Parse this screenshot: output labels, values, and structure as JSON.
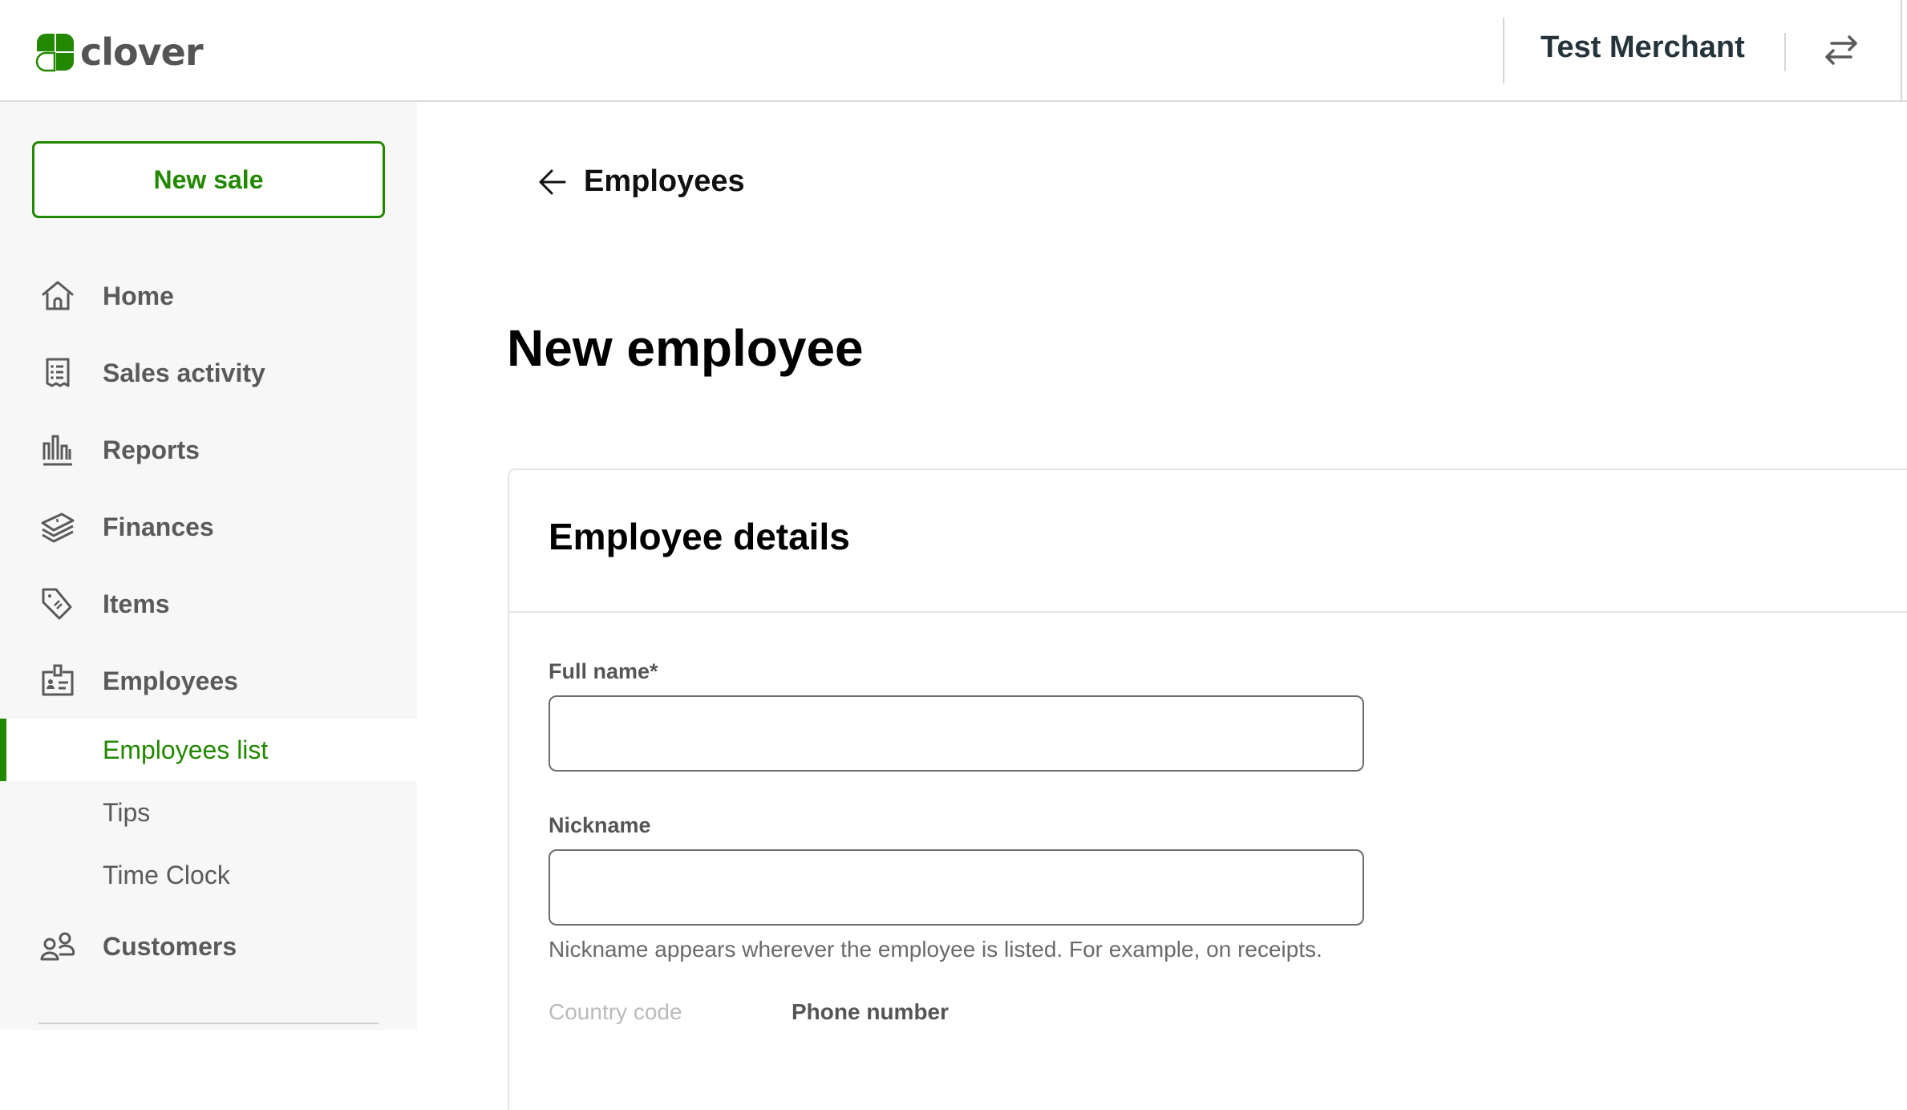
{
  "header": {
    "brand": "clover",
    "merchant_name": "Test Merchant",
    "switch_icon": "swap-arrows-icon"
  },
  "colors": {
    "brand_green": "#228800",
    "text_dark": "#25333b",
    "nav_text": "#5a5a5a",
    "sidebar_bg": "#f7f7f7"
  },
  "sidebar": {
    "new_sale_label": "New sale",
    "items": [
      {
        "label": "Home",
        "icon": "home-icon"
      },
      {
        "label": "Sales activity",
        "icon": "receipt-icon"
      },
      {
        "label": "Reports",
        "icon": "bar-chart-icon"
      },
      {
        "label": "Finances",
        "icon": "money-stack-icon"
      },
      {
        "label": "Items",
        "icon": "tag-icon"
      },
      {
        "label": "Employees",
        "icon": "id-badge-icon"
      }
    ],
    "sub_items": [
      {
        "label": "Employees list",
        "active": true
      },
      {
        "label": "Tips",
        "active": false
      },
      {
        "label": "Time Clock",
        "active": false
      }
    ],
    "customers": {
      "label": "Customers",
      "icon": "customers-icon"
    }
  },
  "main": {
    "back_label": "Employees",
    "page_title": "New employee",
    "card": {
      "title": "Employee details",
      "full_name_label": "Full name*",
      "full_name_value": "",
      "nickname_label": "Nickname",
      "nickname_value": "",
      "nickname_helper": "Nickname appears wherever the employee is listed. For example, on receipts.",
      "country_code_label": "Country code",
      "phone_number_label": "Phone number"
    }
  }
}
